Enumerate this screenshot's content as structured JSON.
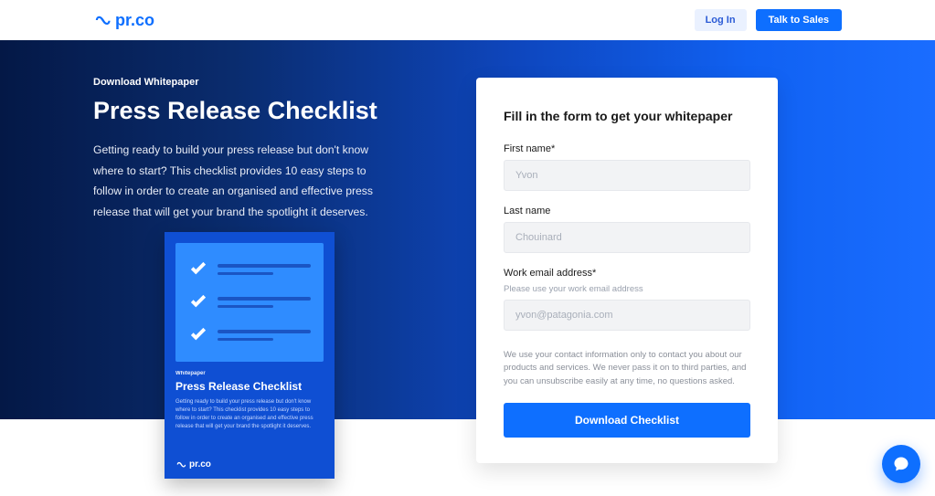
{
  "header": {
    "brand": "pr.co",
    "login": "Log In",
    "sales": "Talk to Sales"
  },
  "hero": {
    "eyebrow": "Download Whitepaper",
    "title": "Press Release Checklist",
    "desc": "Getting ready to build your press release but don't know where to start? This checklist provides 10 easy steps to follow in order to create an organised and effective press release that will get your brand the spotlight it deserves."
  },
  "preview": {
    "eyebrow": "Whitepaper",
    "title": "Press Release Checklist",
    "desc": "Getting ready to build your press release but don't know where to start? This checklist provides 10 easy steps to follow in order to create an organised and effective press release that will get your brand the spotlight it deserves.",
    "brand": "pr.co"
  },
  "form": {
    "title": "Fill in the form to get your whitepaper",
    "first_name_label": "First name*",
    "first_name_placeholder": "Yvon",
    "last_name_label": "Last name",
    "last_name_placeholder": "Chouinard",
    "email_label": "Work email address*",
    "email_hint": "Please use your work email address",
    "email_placeholder": "yvon@patagonia.com",
    "legal": "We use your contact information only to contact you about our products and services. We never pass it on to third parties, and you can unsubscribe easily at any time, no questions asked.",
    "cta": "Download Checklist"
  }
}
